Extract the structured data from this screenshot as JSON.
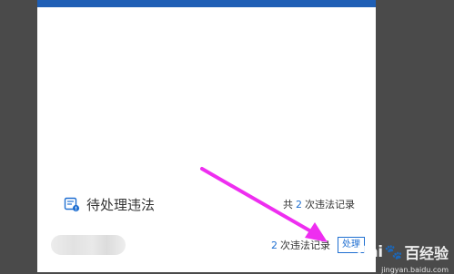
{
  "pending": {
    "title": "待处理违法",
    "total_prefix": "共",
    "total_count": "2",
    "total_suffix": "次违法记录"
  },
  "record": {
    "count": "2",
    "count_suffix": "次违法记录",
    "process_label": "处理"
  },
  "watermark": {
    "logo": "Bai",
    "paw": "🐾",
    "logo_tail": "百",
    "text": "经验",
    "sub": "jingyan.baidu.com"
  },
  "colors": {
    "topbar": "#1f5fb5",
    "accent": "#1f6fd1",
    "arrow": "#ee2ef0",
    "background": "#4a4a4a"
  },
  "icons": {
    "pending": "document-alert-icon"
  }
}
